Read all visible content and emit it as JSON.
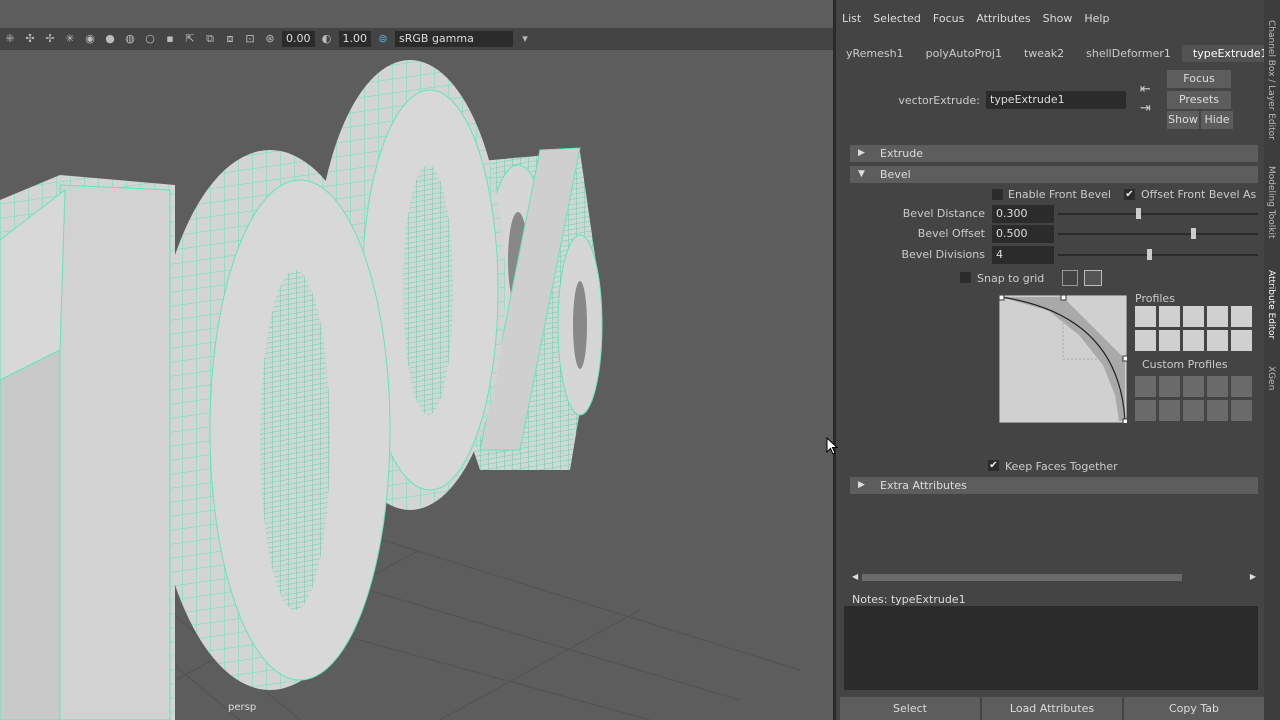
{
  "viewport": {
    "toolbar": {
      "exposure": "0.00",
      "gamma": "1.00",
      "color_space": "sRGB gamma"
    },
    "camera_label": "persp",
    "text_3d": "100%",
    "wire_color": "#5ee8b4"
  },
  "menubar": [
    "List",
    "Selected",
    "Focus",
    "Attributes",
    "Show",
    "Help"
  ],
  "tabs": [
    "yRemesh1",
    "polyAutoProj1",
    "tweak2",
    "shellDeformer1",
    "typeExtrude1"
  ],
  "active_tab": "typeExtrude1",
  "node": {
    "label": "vectorExtrude:",
    "value": "typeExtrude1"
  },
  "side_buttons": {
    "focus": "Focus",
    "presets": "Presets",
    "show": "Show",
    "hide": "Hide"
  },
  "sections": {
    "extrude": "Extrude",
    "bevel": "Bevel",
    "extra": "Extra Attributes"
  },
  "bevel": {
    "enable_front_bevel": {
      "label": "Enable Front Bevel",
      "checked": false
    },
    "offset_front_bevel": {
      "label": "Offset Front Bevel As Fra",
      "checked": true
    },
    "distance": {
      "label": "Bevel Distance",
      "value": "0.300"
    },
    "offset": {
      "label": "Bevel Offset",
      "value": "0.500"
    },
    "divisions": {
      "label": "Bevel Divisions",
      "value": "4"
    },
    "snap_to_grid": {
      "label": "Snap to grid",
      "checked": false
    },
    "profiles_label": "Profiles",
    "custom_profiles_label": "Custom Profiles",
    "keep_faces": {
      "label": "Keep Faces Together",
      "checked": true
    }
  },
  "notes": {
    "label": "Notes:",
    "value": "typeExtrude1"
  },
  "bottom_buttons": [
    "Select",
    "Load Attributes",
    "Copy Tab"
  ],
  "side_panel_tabs": [
    "Channel Box / Layer Editor",
    "Modeling Toolkit",
    "Attribute Editor",
    "XGen"
  ]
}
